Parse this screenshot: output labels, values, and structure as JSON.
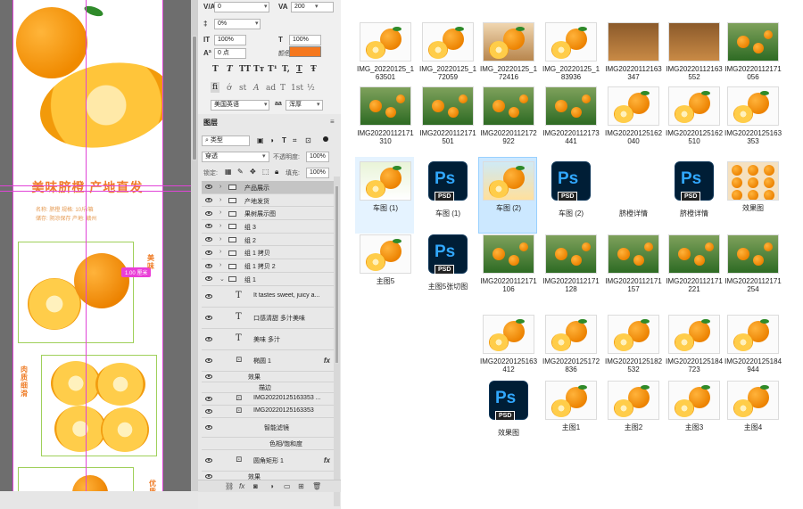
{
  "canvas": {
    "title": "美味脐橙 产地直发",
    "meta_row1": "名称: 脐橙      规格: 10斤/箱",
    "meta_row2": "储存: 阴凉保存   产地: 赣州",
    "badge": "1.00 厘米",
    "side_text1": "美味",
    "side_text2": "肉质细滑",
    "side_text3": "优质"
  },
  "character_panel": {
    "tracking_value": "0",
    "kerning_value": "200",
    "vscale_value": "0%",
    "hscale_value": "100%",
    "baseline_value": "0 点",
    "hscale2_value": "100%",
    "color_label": "颜色:",
    "language": "美国英语",
    "antialias": "浑厚",
    "glyph_row1": [
      "T",
      "T",
      "TT",
      "Tт",
      "T¹",
      "T,",
      "T",
      "Ŧ"
    ],
    "glyph_row2": [
      "fi",
      "ớ",
      "st",
      "A",
      "ad",
      "T",
      "1st",
      "½"
    ]
  },
  "layers_panel": {
    "tab_label": "图层",
    "filter_kind": "类型",
    "blend_mode": "穿透",
    "opacity_label": "不透明度:",
    "opacity_value": "100%",
    "lock_label": "锁定:",
    "fill_label": "填充:",
    "fill_value": "100%",
    "layers": [
      {
        "name": "产品展示",
        "type": "folder"
      },
      {
        "name": "产地发货",
        "type": "folder"
      },
      {
        "name": "果树展示图",
        "type": "folder"
      },
      {
        "name": "组 3",
        "type": "folder"
      },
      {
        "name": "组 2",
        "type": "folder"
      },
      {
        "name": "组 1 拷贝",
        "type": "folder"
      },
      {
        "name": "组 1 拷贝 2",
        "type": "folder"
      },
      {
        "name": "组 1",
        "type": "folder"
      },
      {
        "name": "It tastes sweet, juicy a...",
        "type": "text"
      },
      {
        "name": "口感清甜  多汁美味",
        "type": "text"
      },
      {
        "name": "美味 多汁",
        "type": "text"
      },
      {
        "name": "椭圆 1",
        "type": "shape"
      },
      {
        "name": "效果",
        "type": "effect"
      },
      {
        "name": "描边",
        "type": "effect-sub"
      },
      {
        "name": "IMG20220125163353 ...",
        "type": "smart"
      },
      {
        "name": "IMG20220125163353",
        "type": "smart"
      },
      {
        "name": "智能滤镜",
        "type": "filter"
      },
      {
        "name": "色相/饱和度",
        "type": "filter-sub"
      },
      {
        "name": "圆角矩形 1",
        "type": "shape"
      },
      {
        "name": "效果",
        "type": "effect"
      }
    ]
  },
  "files": [
    {
      "name": "IMG_20220125_163501",
      "kind": "white"
    },
    {
      "name": "IMG_20220125_172059",
      "kind": "white"
    },
    {
      "name": "IMG_20220125_172416",
      "kind": "wood"
    },
    {
      "name": "IMG_20220125_183936",
      "kind": "white"
    },
    {
      "name": "IMG20220112163347",
      "kind": "box"
    },
    {
      "name": "IMG20220112163552",
      "kind": "box"
    },
    {
      "name": "IMG20220112171056",
      "kind": "garden"
    },
    {
      "name": "IMG20220112171310",
      "kind": "garden"
    },
    {
      "name": "IMG20220112171501",
      "kind": "garden"
    },
    {
      "name": "IMG20220112172922",
      "kind": "garden"
    },
    {
      "name": "IMG20220112173441",
      "kind": "garden"
    },
    {
      "name": "IMG20220125162040",
      "kind": "white"
    },
    {
      "name": "IMG20220125162510",
      "kind": "white"
    },
    {
      "name": "IMG20220125163353",
      "kind": "white"
    },
    {
      "name": "车图 (1)",
      "kind": "design"
    },
    {
      "name": "车图 (1)",
      "kind": "psd"
    },
    {
      "name": "车图 (2)",
      "kind": "promo"
    },
    {
      "name": "车图 (2)",
      "kind": "psd"
    },
    {
      "name": "脐橙详情",
      "kind": "blank"
    },
    {
      "name": "脐橙详情",
      "kind": "psd"
    },
    {
      "name": "效果图",
      "kind": "grid"
    },
    {
      "name": "主图5",
      "kind": "white"
    },
    {
      "name": "主图5张切图",
      "kind": "psd"
    },
    {
      "name": "IMG20220112171106",
      "kind": "garden"
    },
    {
      "name": "IMG20220112171128",
      "kind": "garden"
    },
    {
      "name": "IMG20220112171157",
      "kind": "garden"
    },
    {
      "name": "IMG20220112171221",
      "kind": "garden"
    },
    {
      "name": "IMG20220112171254",
      "kind": "garden"
    },
    {
      "name": "IMG20220125163412",
      "kind": "white"
    },
    {
      "name": "IMG20220125172836",
      "kind": "white"
    },
    {
      "name": "IMG20220125182532",
      "kind": "white"
    },
    {
      "name": "IMG20220125184723",
      "kind": "white"
    },
    {
      "name": "IMG20220125184944",
      "kind": "white"
    },
    {
      "name": "效果图",
      "kind": "psd"
    },
    {
      "name": "主图1",
      "kind": "white"
    },
    {
      "name": "主图2",
      "kind": "white"
    },
    {
      "name": "主图3",
      "kind": "white"
    },
    {
      "name": "主图4",
      "kind": "white"
    }
  ],
  "colors": {
    "accent_orange": "#f5781e",
    "selection_blue": "#cce8ff",
    "ps_blue": "#31a8ff",
    "ps_dark": "#001e36"
  }
}
